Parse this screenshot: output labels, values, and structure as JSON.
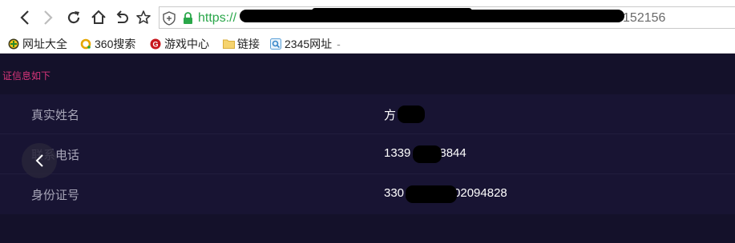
{
  "browser": {
    "url_scheme": "https://",
    "url_visible_tail": "152156",
    "icons": {
      "back": "back-arrow-icon",
      "forward": "forward-arrow-icon",
      "reload": "reload-icon",
      "home": "home-icon",
      "undo": "undo-close-tab-icon",
      "favorite": "star-icon",
      "security": "shield-icon",
      "lock": "lock-icon"
    }
  },
  "bookmarks": [
    {
      "label": "网址大全",
      "icon": "plus-badge-icon"
    },
    {
      "label": "360搜索",
      "icon": "360-search-icon"
    },
    {
      "label": "游戏中心",
      "icon": "game-center-icon"
    },
    {
      "label": "链接",
      "icon": "folder-icon"
    },
    {
      "label": "2345网址",
      "icon": "2345-icon"
    }
  ],
  "bookmark_more": "-",
  "page": {
    "title": "证信息如下",
    "rows": [
      {
        "label": "真实姓名",
        "value": "方"
      },
      {
        "label": "联系电话",
        "value_start": "1339",
        "value_end": "8844"
      },
      {
        "label": "身份证号",
        "value_start": "330",
        "value_end": "02094828"
      }
    ]
  },
  "colors": {
    "page_bg": "#14112a",
    "panel_bg": "#181433",
    "title_pink": "#d8357a",
    "label_gray": "#a8a6b8",
    "value_white": "#ffffff",
    "url_green": "#2aa74a"
  }
}
